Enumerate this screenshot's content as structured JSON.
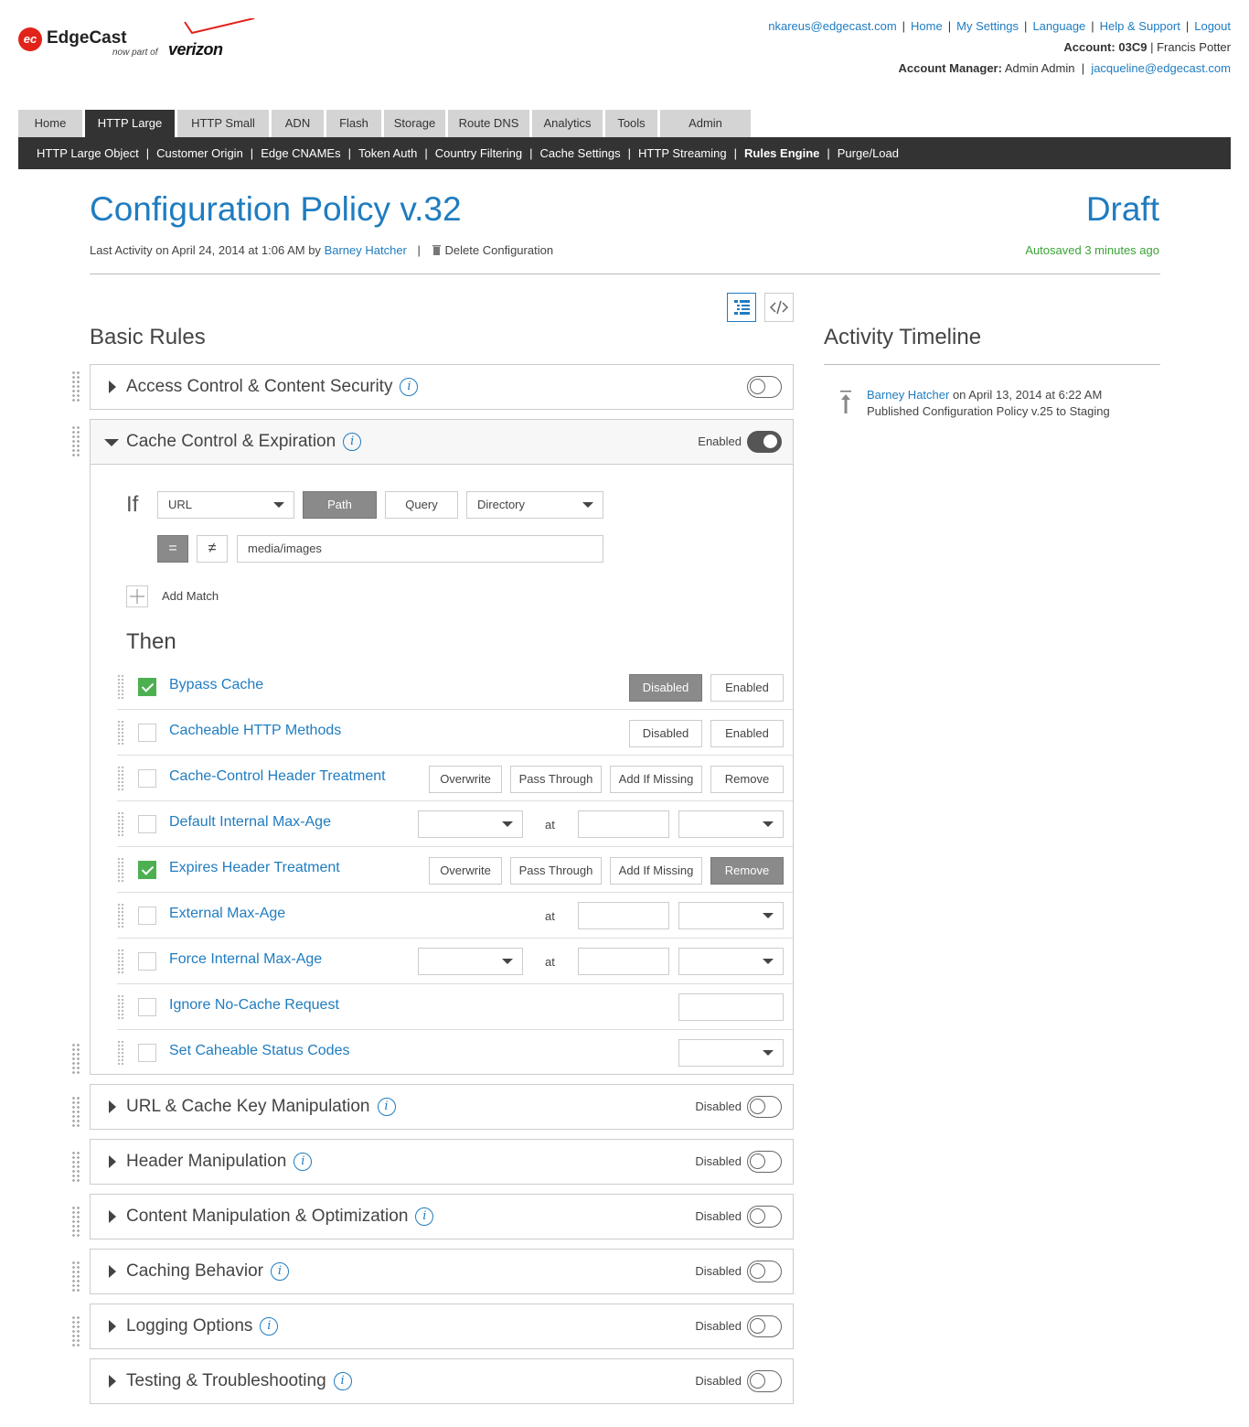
{
  "brand": {
    "mark": "ec",
    "name": "EdgeCast",
    "sub": "now part of",
    "parent": "verizon"
  },
  "toplinks": [
    "nkareus@edgecast.com",
    "Home",
    "My Settings",
    "Language",
    "Help & Support",
    "Logout"
  ],
  "account": {
    "label": "Account:",
    "id": "03C9",
    "name": "Francis Potter"
  },
  "manager": {
    "label": "Account Manager:",
    "name": "Admin Admin",
    "email": "jacqueline@edgecast.com"
  },
  "tabs": [
    "Home",
    "HTTP Large",
    "HTTP Small",
    "ADN",
    "Flash",
    "Storage",
    "Route DNS",
    "Analytics",
    "Tools",
    "Admin"
  ],
  "active_tab": "HTTP Large",
  "subnav": [
    "HTTP Large Object",
    "Customer Origin",
    "Edge CNAMEs",
    "Token Auth",
    "Country Filtering",
    "Cache Settings",
    "HTTP Streaming",
    "Rules Engine",
    "Purge/Load"
  ],
  "active_subnav": "Rules Engine",
  "page": {
    "title": "Configuration Policy v.32",
    "status": "Draft",
    "meta_prefix": "Last Activity on April 24, 2014 at 1:06 AM by",
    "meta_user": "Barney Hatcher",
    "delete_label": "Delete Configuration",
    "autosave": "Autosaved 3 minutes ago"
  },
  "basic_rules_heading": "Basic Rules",
  "activity": {
    "heading": "Activity Timeline",
    "user": "Barney Hatcher",
    "when": "on April 13, 2014 at 6:22 AM",
    "desc": "Published Configuration Policy v.25 to Staging"
  },
  "panels": {
    "access": {
      "title": "Access Control & Content Security",
      "state": "",
      "enabled": false
    },
    "cache": {
      "title": "Cache Control & Expiration",
      "state": "Enabled",
      "enabled": true
    },
    "url": {
      "title": "URL & Cache Key Manipulation",
      "state": "Disabled",
      "enabled": false
    },
    "header": {
      "title": "Header Manipulation",
      "state": "Disabled",
      "enabled": false
    },
    "content": {
      "title": "Content Manipulation & Optimization",
      "state": "Disabled",
      "enabled": false
    },
    "caching": {
      "title": "Caching Behavior",
      "state": "Disabled",
      "enabled": false
    },
    "logging": {
      "title": "Logging Options",
      "state": "Disabled",
      "enabled": false
    },
    "testing": {
      "title": "Testing & Troubleshooting",
      "state": "Disabled",
      "enabled": false
    }
  },
  "condition": {
    "if_label": "If",
    "field": "URL",
    "path_label": "Path",
    "query_label": "Query",
    "scope": "Directory",
    "eq": "=",
    "neq": "≠",
    "value": "media/images",
    "add_match": "Add Match"
  },
  "then_label": "Then",
  "at_label": "at",
  "rules": {
    "bypass": {
      "name": "Bypass Cache",
      "checked": true,
      "disabled": "Disabled",
      "enabled": "Enabled",
      "selected": "Disabled"
    },
    "methods": {
      "name": "Cacheable HTTP Methods",
      "checked": false,
      "disabled": "Disabled",
      "enabled": "Enabled"
    },
    "cc_header": {
      "name": "Cache-Control Header Treatment",
      "checked": false,
      "options": [
        "Overwrite",
        "Pass Through",
        "Add If Missing",
        "Remove"
      ]
    },
    "default_age": {
      "name": "Default Internal Max-Age",
      "checked": false
    },
    "expires": {
      "name": "Expires Header Treatment",
      "checked": true,
      "options": [
        "Overwrite",
        "Pass Through",
        "Add If Missing",
        "Remove"
      ],
      "selected": "Remove"
    },
    "external_age": {
      "name": "External Max-Age",
      "checked": false
    },
    "force_age": {
      "name": "Force Internal Max-Age",
      "checked": false
    },
    "ignore_nocache": {
      "name": "Ignore No-Cache Request",
      "checked": false
    },
    "status_codes": {
      "name": "Set Caheable Status Codes",
      "checked": false
    }
  },
  "colors": {
    "link": "#1f7cc0",
    "nav_dark": "#333333",
    "autosave": "#3aa336",
    "check_green": "#4cb050",
    "selected_btn": "#8a8a8a"
  },
  "icons": [
    "logo-mark",
    "info-icon",
    "caret-right-icon",
    "caret-down-icon",
    "toggle-icon",
    "list-view-icon",
    "code-view-icon",
    "trash-icon",
    "publish-icon",
    "drag-handle-icon",
    "plus-icon",
    "check-icon",
    "chevron-down-icon"
  ]
}
